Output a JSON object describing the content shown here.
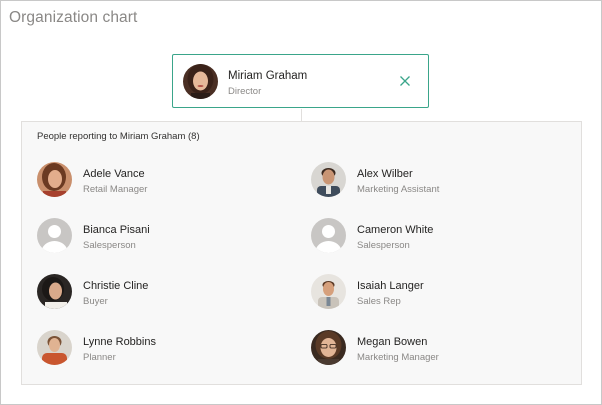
{
  "page": {
    "title": "Organization chart"
  },
  "manager": {
    "name": "Miriam Graham",
    "title": "Director",
    "accent_color": "#3aa58a"
  },
  "reports": {
    "heading": "People reporting to Miriam Graham (8)",
    "people": [
      {
        "name": "Adele Vance",
        "title": "Retail Manager",
        "photo": "photo"
      },
      {
        "name": "Alex Wilber",
        "title": "Marketing Assistant",
        "photo": "photo"
      },
      {
        "name": "Bianca Pisani",
        "title": "Salesperson",
        "photo": "placeholder"
      },
      {
        "name": "Cameron White",
        "title": "Salesperson",
        "photo": "placeholder"
      },
      {
        "name": "Christie Cline",
        "title": "Buyer",
        "photo": "photo"
      },
      {
        "name": "Isaiah Langer",
        "title": "Sales Rep",
        "photo": "photo"
      },
      {
        "name": "Lynne Robbins",
        "title": "Planner",
        "photo": "photo"
      },
      {
        "name": "Megan Bowen",
        "title": "Marketing Manager",
        "photo": "photo"
      }
    ]
  },
  "icons": {
    "close": "close-icon",
    "placeholder_avatar": "person-placeholder-icon"
  }
}
